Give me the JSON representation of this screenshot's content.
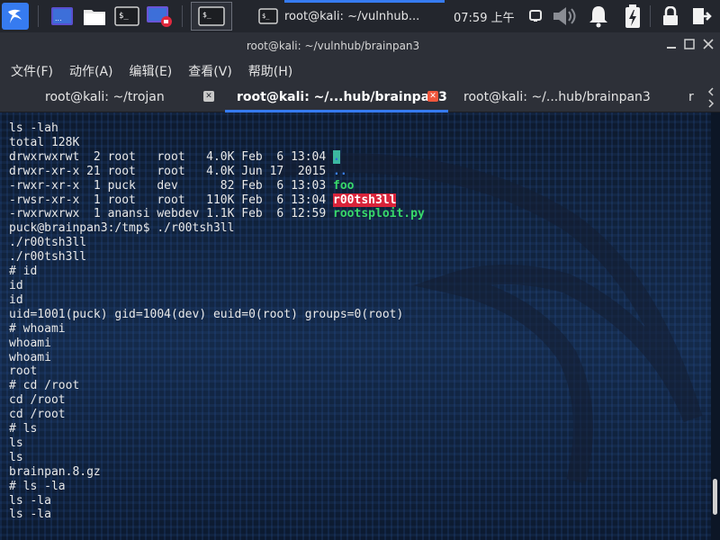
{
  "taskbar": {
    "task_title": "root@kali: ~/vulnhub...",
    "clock": "07:59 上午",
    "accent": "#367bf0"
  },
  "window": {
    "title": "root@kali: ~/vulnhub/brainpan3",
    "controls": [
      "minimize",
      "maximize",
      "close"
    ]
  },
  "menubar": [
    "文件(F)",
    "动作(A)",
    "编辑(E)",
    "查看(V)",
    "帮助(H)"
  ],
  "tabs": [
    {
      "label": "root@kali: ~/trojan",
      "active": false
    },
    {
      "label": "root@kali: ~/...hub/brainpan3",
      "active": true
    },
    {
      "label": "root@kali: ~/...hub/brainpan3",
      "active": false
    },
    {
      "label": "r",
      "active": false
    }
  ],
  "terminal": {
    "ls_lines": [
      {
        "meta": "drwxrwxrwt  2 root   root   4.0K Feb  6 13:04 ",
        "name": ".",
        "style": "dot"
      },
      {
        "meta": "drwxr-xr-x 21 root   root   4.0K Jun 17  2015 ",
        "name": "..",
        "style": "dotdot"
      },
      {
        "meta": "-rwxr-xr-x  1 puck   dev      82 Feb  6 13:03 ",
        "name": "foo",
        "style": "exec"
      },
      {
        "meta": "-rwsr-xr-x  1 root   root   110K Feb  6 13:04 ",
        "name": "r00tsh3ll",
        "style": "suid"
      },
      {
        "meta": "-rwxrwxrwx  1 anansi webdev 1.1K Feb  6 12:59 ",
        "name": "rootsploit.py",
        "style": "exec"
      }
    ],
    "line_ls": "ls -lah",
    "line_total": "total 128K",
    "rest": [
      "puck@brainpan3:/tmp$ ./r00tsh3ll",
      "./r00tsh3ll",
      "./r00tsh3ll",
      "# id",
      "id",
      "id",
      "uid=1001(puck) gid=1004(dev) euid=0(root) groups=0(root)",
      "# whoami",
      "whoami",
      "whoami",
      "root",
      "# cd /root",
      "cd /root",
      "cd /root",
      "# ls",
      "ls",
      "ls",
      "brainpan.8.gz",
      "# ls -la",
      "ls -la",
      "ls -la"
    ]
  }
}
